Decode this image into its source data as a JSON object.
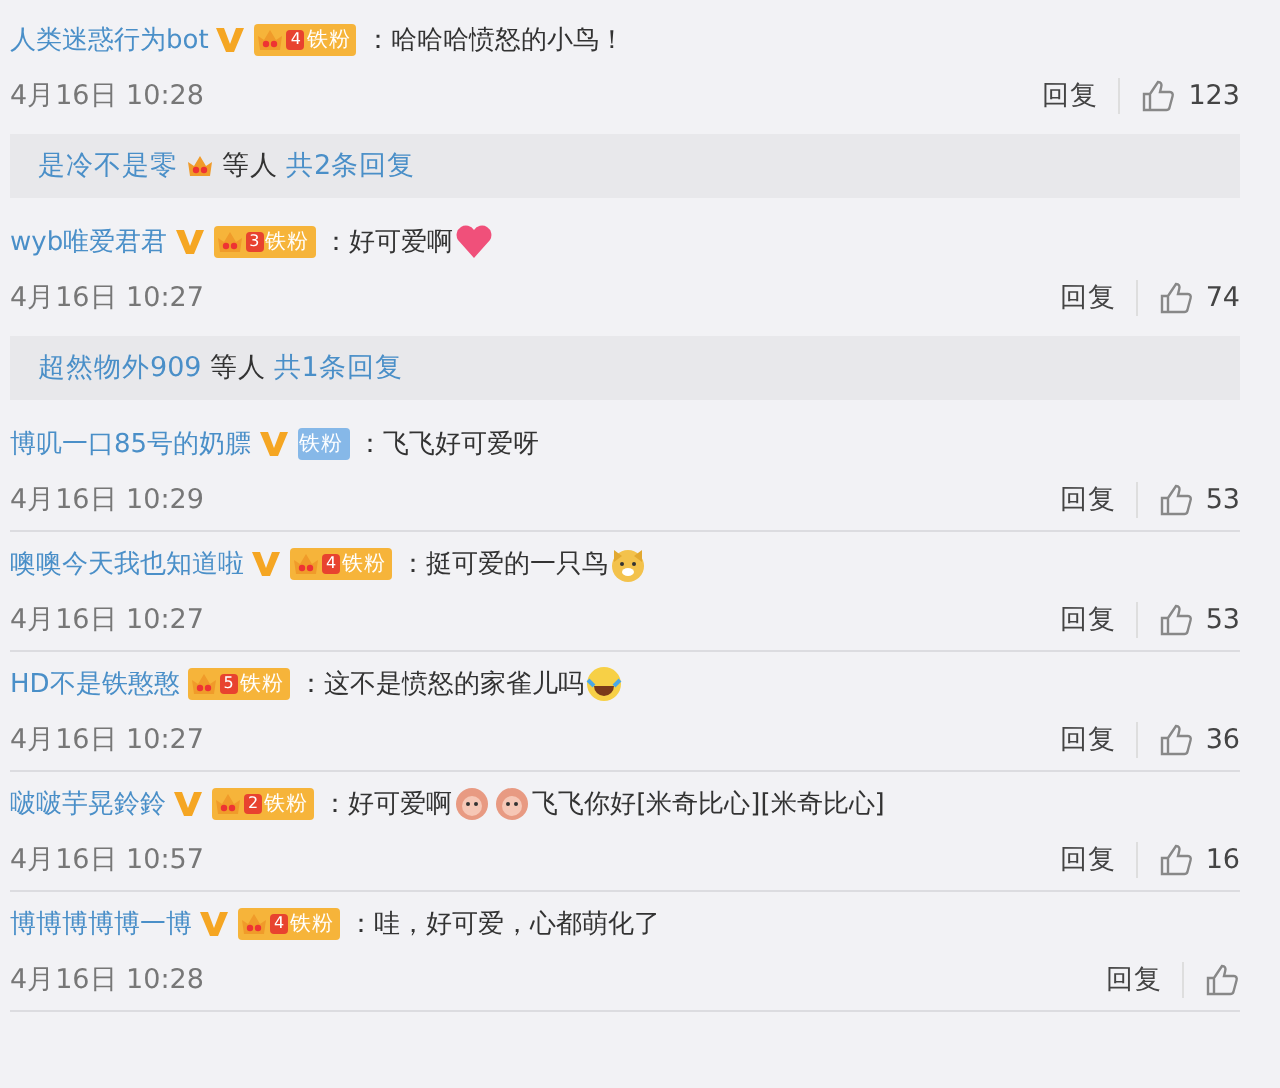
{
  "comments": [
    {
      "name": "人类迷惑行为bot",
      "verified": true,
      "badge": {
        "kind": "crown",
        "level": "4",
        "label": "铁粉"
      },
      "parts": [
        {
          "kind": "text",
          "text": "：哈哈哈愤怒的小鸟！"
        }
      ],
      "time": "4月16日 10:28",
      "reply": "回复",
      "likes": "123",
      "replies": {
        "name": "是冷不是零",
        "crown": true,
        "suffix": "等人",
        "link": "共2条回复"
      }
    },
    {
      "name": "wyb唯爱君君",
      "verified": true,
      "badge": {
        "kind": "crown",
        "level": "3",
        "label": "铁粉"
      },
      "parts": [
        {
          "kind": "text",
          "text": "：好可爱啊"
        },
        {
          "kind": "heart"
        }
      ],
      "time": "4月16日 10:27",
      "reply": "回复",
      "likes": "74",
      "replies": {
        "name": "超然物外909",
        "crown": false,
        "suffix": "等人",
        "link": "共1条回复"
      }
    },
    {
      "name": "博叽一口85号的奶膘",
      "verified": true,
      "badge": {
        "kind": "plain",
        "label": "铁粉"
      },
      "parts": [
        {
          "kind": "text",
          "text": "：飞飞好可爱呀"
        }
      ],
      "time": "4月16日 10:29",
      "reply": "回复",
      "likes": "53"
    },
    {
      "name": "噢噢今天我也知道啦",
      "verified": true,
      "badge": {
        "kind": "crown",
        "level": "4",
        "label": "铁粉"
      },
      "parts": [
        {
          "kind": "text",
          "text": "：挺可爱的一只鸟"
        },
        {
          "kind": "dog"
        }
      ],
      "time": "4月16日 10:27",
      "reply": "回复",
      "likes": "53"
    },
    {
      "name": "HD不是铁憨憨",
      "verified": false,
      "badge": {
        "kind": "crown",
        "level": "5",
        "label": "铁粉"
      },
      "parts": [
        {
          "kind": "text",
          "text": "：这不是愤怒的家雀儿吗"
        },
        {
          "kind": "laugh"
        }
      ],
      "time": "4月16日 10:27",
      "reply": "回复",
      "likes": "36"
    },
    {
      "name": "啵啵芋晃鈴鈴",
      "verified": true,
      "badge": {
        "kind": "crown",
        "level": "2",
        "label": "铁粉"
      },
      "parts": [
        {
          "kind": "text",
          "text": "：好可爱啊"
        },
        {
          "kind": "doll"
        },
        {
          "kind": "doll"
        },
        {
          "kind": "text",
          "text": "飞飞你好[米奇比心][米奇比心]"
        }
      ],
      "time": "4月16日 10:57",
      "reply": "回复",
      "likes": "16"
    },
    {
      "name": "博博博博博一博",
      "verified": true,
      "badge": {
        "kind": "crown",
        "level": "4",
        "label": "铁粉"
      },
      "parts": [
        {
          "kind": "text",
          "text": "：哇，好可爱，心都萌化了"
        }
      ],
      "time": "4月16日 10:28",
      "reply": "回复"
    }
  ]
}
